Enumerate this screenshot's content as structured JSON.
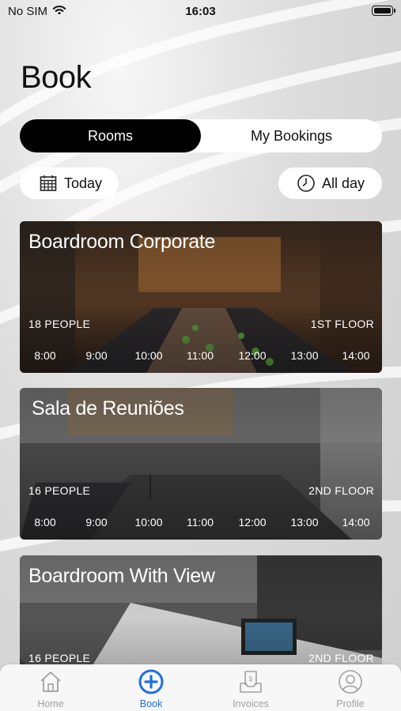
{
  "status_bar": {
    "carrier": "No SIM",
    "time": "16:03"
  },
  "page_title": "Book",
  "segmented": {
    "active": "Rooms",
    "inactive": "My Bookings"
  },
  "filters": {
    "date_label": "Today",
    "time_label": "All day"
  },
  "rooms": [
    {
      "name": "Boardroom Corporate",
      "capacity": "18 PEOPLE",
      "floor": "1ST FLOOR",
      "slots": [
        "8:00",
        "9:00",
        "10:00",
        "11:00",
        "12:00",
        "13:00",
        "14:00"
      ]
    },
    {
      "name": "Sala de Reuniões",
      "capacity": "16 PEOPLE",
      "floor": "2ND FLOOR",
      "slots": [
        "8:00",
        "9:00",
        "10:00",
        "11:00",
        "12:00",
        "13:00",
        "14:00"
      ]
    },
    {
      "name": "Boardroom With View",
      "capacity": "16 PEOPLE",
      "floor": "2ND FLOOR"
    }
  ],
  "tabs": [
    {
      "label": "Home",
      "icon": "home-icon",
      "active": false
    },
    {
      "label": "Book",
      "icon": "plus-circle-icon",
      "active": true
    },
    {
      "label": "Invoices",
      "icon": "invoice-icon",
      "active": false
    },
    {
      "label": "Profile",
      "icon": "profile-icon",
      "active": false
    }
  ],
  "colors": {
    "accent": "#1d6fe0",
    "segment_active": "#000000",
    "tab_inactive": "#a0a0a0"
  }
}
